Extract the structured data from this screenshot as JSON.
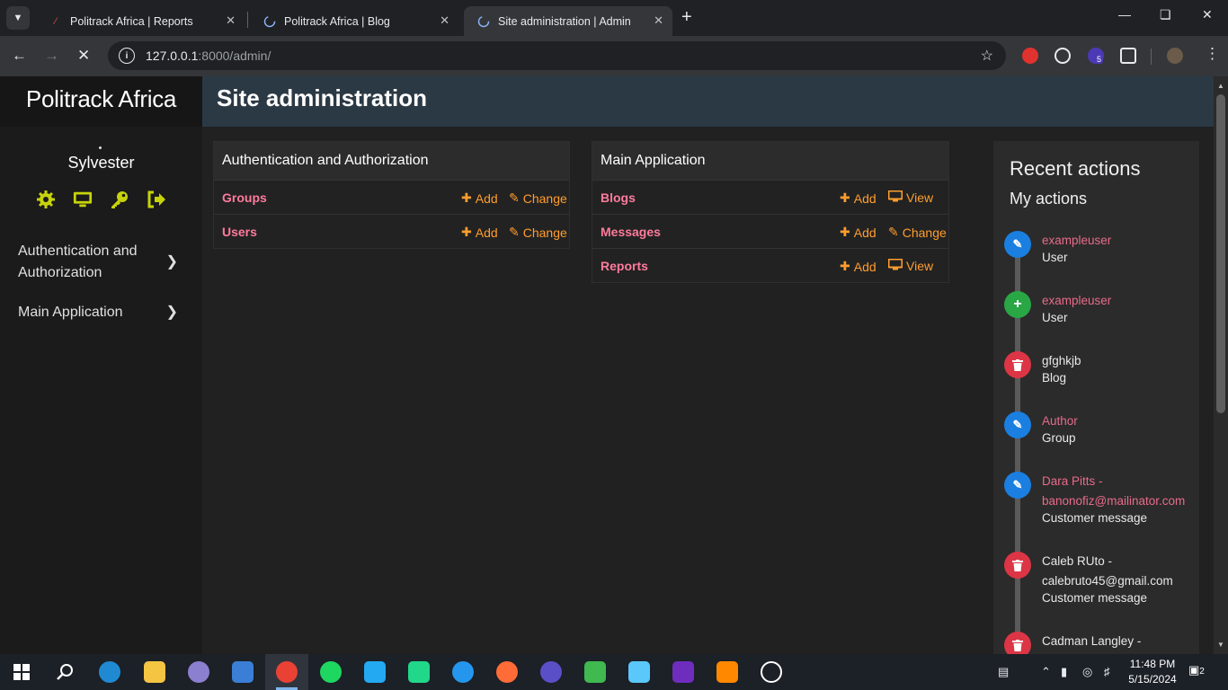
{
  "browser": {
    "tabs": [
      {
        "title": "Politrack Africa | Reports",
        "active": false
      },
      {
        "title": "Politrack Africa | Blog",
        "active": false
      },
      {
        "title": "Site administration | Admin",
        "active": true
      }
    ],
    "url_host": "127.0.0.1",
    "url_path": ":8000/admin/",
    "extension_badge": "5"
  },
  "sidebar": {
    "brand": "Politrack Africa",
    "username": "Sylvester",
    "user_icons": [
      "cog-icon",
      "monitor-icon",
      "key-icon",
      "logout-icon"
    ],
    "nav": [
      {
        "label_line1": "Authentication and",
        "label_line2": "Authorization"
      },
      {
        "label": "Main Application"
      }
    ]
  },
  "header": {
    "title": "Site administration"
  },
  "modules": [
    {
      "caption": "Authentication and Authorization",
      "rows": [
        {
          "name": "Groups",
          "add": "Add",
          "second": "Change",
          "second_icon": "pencil-icon"
        },
        {
          "name": "Users",
          "add": "Add",
          "second": "Change",
          "second_icon": "pencil-icon"
        }
      ]
    },
    {
      "caption": "Main Application",
      "rows": [
        {
          "name": "Blogs",
          "add": "Add",
          "second": "View",
          "second_icon": "monitor-icon"
        },
        {
          "name": "Messages",
          "add": "Add",
          "second": "Change",
          "second_icon": "pencil-icon"
        },
        {
          "name": "Reports",
          "add": "Add",
          "second": "View",
          "second_icon": "monitor-icon"
        }
      ]
    }
  ],
  "recent": {
    "title": "Recent actions",
    "subtitle": "My actions",
    "items": [
      {
        "action": "edit",
        "color": "#1a7fe0",
        "title": "exampleuser",
        "type": "User",
        "linked": true
      },
      {
        "action": "add",
        "color": "#29a745",
        "title": "exampleuser",
        "type": "User",
        "linked": true
      },
      {
        "action": "delete",
        "color": "#dc3545",
        "title": "gfghkjb",
        "type": "Blog",
        "linked": false
      },
      {
        "action": "edit",
        "color": "#1a7fe0",
        "title": "Author",
        "type": "Group",
        "linked": true
      },
      {
        "action": "edit",
        "color": "#1a7fe0",
        "title": "Dara Pitts - banonofiz@mailinator.com",
        "type": "Customer message",
        "linked": true
      },
      {
        "action": "delete",
        "color": "#dc3545",
        "title": "Caleb RUto - calebruto45@gmail.com",
        "type": "Customer message",
        "linked": false
      },
      {
        "action": "delete",
        "color": "#dc3545",
        "title": "Cadman Langley -",
        "type": "",
        "linked": false
      }
    ]
  },
  "taskbar": {
    "time": "11:48 PM",
    "date": "5/15/2024",
    "notifications": "2"
  },
  "colors": {
    "accent_orange": "#ff9d2e",
    "model_link": "#ff7b9c",
    "user_icon": "#c6d30b",
    "header_bg": "#2b3944"
  }
}
